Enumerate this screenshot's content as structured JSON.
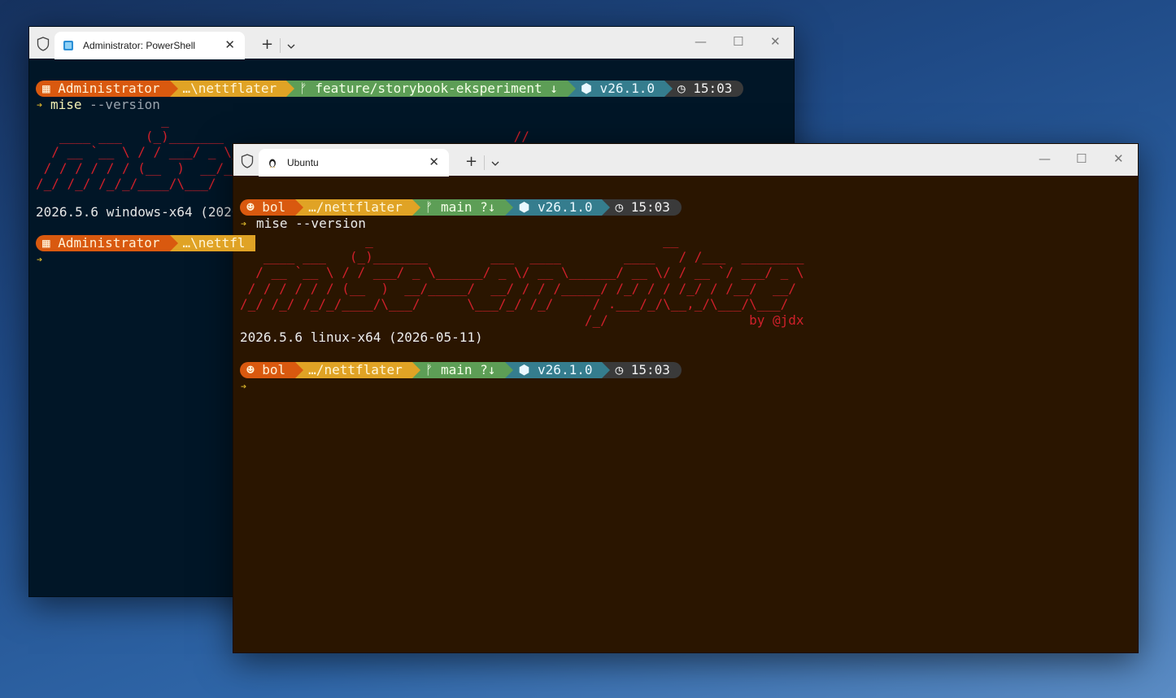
{
  "colors": {
    "ps_bg": "#011627",
    "ub_bg": "#2a1500",
    "seg_user": "#d9590f",
    "seg_path": "#e0a325",
    "seg_git": "#5d9e56",
    "seg_node": "#357d8e",
    "seg_time": "#3a3a3a",
    "art": "#d0202a"
  },
  "powershell": {
    "tab_title": "Administrator: PowerShell",
    "tab_icon": "powershell-icon",
    "prompt1": {
      "user": "▦ Administrator",
      "path": "…\\nettflater",
      "git": "ᚠ feature/storybook-eksperiment ↓",
      "node": "⬢ v26.1.0",
      "time": "◷ 15:03"
    },
    "caret": "➔",
    "cmd": "mise",
    "cmd_args": " --version",
    "art_lines": [
      "                _",
      "   ____ ___   (_)_______",
      "  / __ `__ \\ / / ___/ _ \\___",
      " / / / / / / (__  )  __/___",
      "/_/ /_/ /_/_/____/\\___/"
    ],
    "art_extra": "                                     ___  ____        ____   //___  ________",
    "version_line": "2026.5.6 windows-x64 (2026-",
    "prompt2": {
      "user": "▦ Administrator",
      "path": "…\\nettfl"
    }
  },
  "ubuntu": {
    "tab_title": "Ubuntu",
    "tab_icon": "linux-penguin-icon",
    "prompt": {
      "user": "☻ bol",
      "path": "…/nettflater",
      "git": "ᚠ main ?↓",
      "node": "⬢ v26.1.0",
      "time": "◷ 15:03"
    },
    "caret": "➔",
    "cmd": "mise --version",
    "art_lines": [
      "                _                                     __",
      "   ____ ___   (_)_______        ___  ____        ____   / /___  ________",
      "  / __ `__ \\ / / ___/ _ \\______/ _ \\/ __ \\______/ __ \\/ / __ `/ ___/ _ \\",
      " / / / / / / (__  )  __/_____/  __/ / / /_____/ /_/ / / /_/ / /__/  __/",
      "/_/ /_/ /_/_/____/\\___/      \\___/_/ /_/     / .___/_/\\__,_/\\___/\\___/",
      "                                            /_/                  by @jdx"
    ],
    "version_line": "2026.5.6 linux-x64 (2026-05-11)"
  },
  "window_controls": {
    "minimize": "—",
    "maximize": "☐",
    "close": "✕"
  },
  "new_tab": "+"
}
